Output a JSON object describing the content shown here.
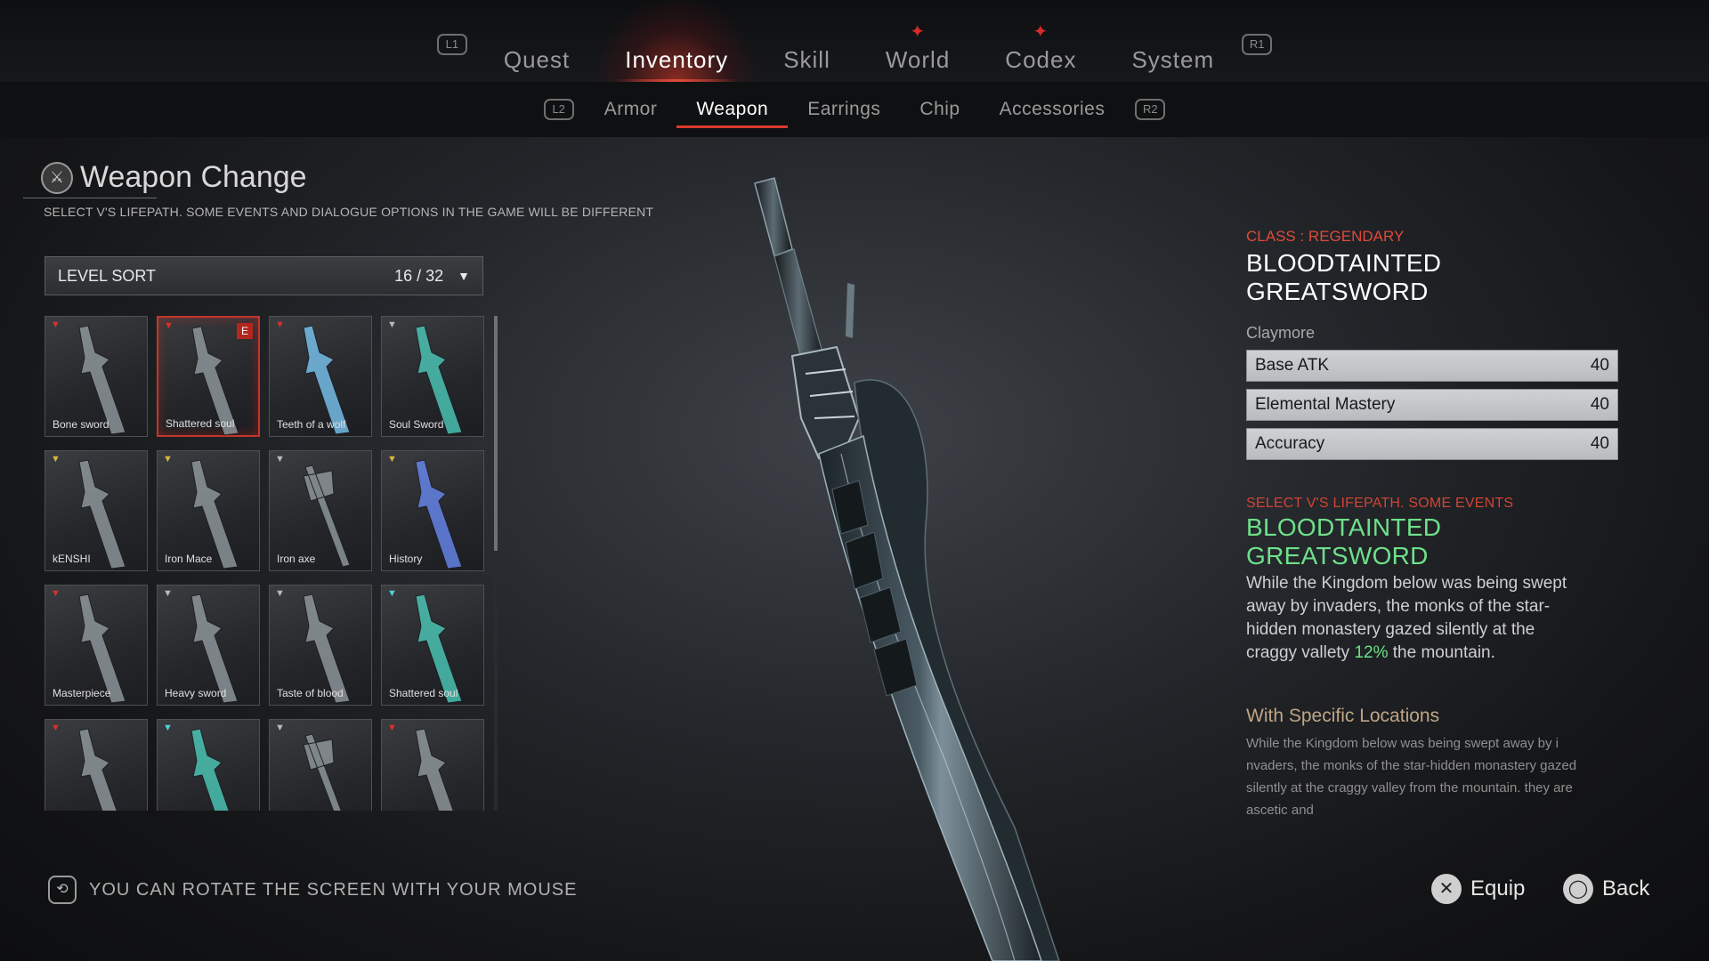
{
  "top_nav": {
    "left_hint": "L1",
    "right_hint": "R1",
    "tabs": [
      {
        "label": "Quest",
        "active": false,
        "badge": false
      },
      {
        "label": "Inventory",
        "active": true,
        "badge": false
      },
      {
        "label": "Skill",
        "active": false,
        "badge": false
      },
      {
        "label": "World",
        "active": false,
        "badge": true
      },
      {
        "label": "Codex",
        "active": false,
        "badge": true
      },
      {
        "label": "System",
        "active": false,
        "badge": false
      }
    ]
  },
  "sub_nav": {
    "left_hint": "L2",
    "right_hint": "R2",
    "tabs": [
      {
        "label": "Armor",
        "active": false
      },
      {
        "label": "Weapon",
        "active": true
      },
      {
        "label": "Earrings",
        "active": false
      },
      {
        "label": "Chip",
        "active": false
      },
      {
        "label": "Accessories",
        "active": false
      }
    ]
  },
  "panel": {
    "title": "Weapon Change",
    "subtitle": "SELECT V'S LIFEPATH. SOME EVENTS AND DIALOGUE OPTIONS IN THE GAME WILL BE DIFFERENT"
  },
  "sort": {
    "label": "LEVEL SORT",
    "count": "16 / 32"
  },
  "colors": {
    "accent_red": "#e04a3a",
    "highlight_green": "#6ee08a",
    "rarity_red": "#d9302a",
    "rarity_gold": "#d6b63a",
    "rarity_silver": "#b8b8b8",
    "rarity_cyan": "#4fd1d9"
  },
  "weapons": [
    {
      "label": "Bone sword",
      "rarity": "red",
      "selected": false,
      "equipped": false,
      "icon": "bone-sword-icon"
    },
    {
      "label": "Shattered soul",
      "rarity": "red",
      "selected": true,
      "equipped": true,
      "equipped_badge": "E",
      "icon": "shattered-soul-icon"
    },
    {
      "label": "Teeth of a wolf",
      "rarity": "red",
      "selected": false,
      "equipped": false,
      "icon": "teeth-of-a-wolf-icon"
    },
    {
      "label": "Soul Sword",
      "rarity": "silver",
      "selected": false,
      "equipped": false,
      "icon": "soul-sword-icon"
    },
    {
      "label": "kENSHI",
      "rarity": "gold",
      "selected": false,
      "equipped": false,
      "icon": "kenshi-icon"
    },
    {
      "label": "Iron Mace",
      "rarity": "gold",
      "selected": false,
      "equipped": false,
      "icon": "iron-mace-icon"
    },
    {
      "label": "Iron axe",
      "rarity": "silver",
      "selected": false,
      "equipped": false,
      "icon": "iron-axe-icon"
    },
    {
      "label": "History",
      "rarity": "gold",
      "selected": false,
      "equipped": false,
      "icon": "history-icon"
    },
    {
      "label": "Masterpiece",
      "rarity": "red",
      "selected": false,
      "equipped": false,
      "icon": "masterpiece-icon"
    },
    {
      "label": "Heavy sword",
      "rarity": "silver",
      "selected": false,
      "equipped": false,
      "icon": "heavy-sword-icon"
    },
    {
      "label": "Taste of blood",
      "rarity": "silver",
      "selected": false,
      "equipped": false,
      "icon": "taste-of-blood-icon"
    },
    {
      "label": "Shattered soul",
      "rarity": "cyan",
      "selected": false,
      "equipped": false,
      "icon": "shattered-soul-icon"
    },
    {
      "label": "",
      "rarity": "red",
      "selected": false,
      "equipped": false,
      "icon": "sword-icon"
    },
    {
      "label": "",
      "rarity": "cyan",
      "selected": false,
      "equipped": false,
      "icon": "sword-icon"
    },
    {
      "label": "",
      "rarity": "silver",
      "selected": false,
      "equipped": false,
      "icon": "axe-icon"
    },
    {
      "label": "",
      "rarity": "red",
      "selected": false,
      "equipped": false,
      "icon": "sword-icon"
    }
  ],
  "item": {
    "class_label": "CLASS : REGENDARY",
    "name": "BLOODTAINTED GREATSWORD",
    "type": "Claymore",
    "stats": [
      {
        "name": "Base ATK",
        "value": "40"
      },
      {
        "name": "Elemental Mastery",
        "value": "40"
      },
      {
        "name": "Accuracy",
        "value": "40"
      }
    ],
    "desc_kicker": "SELECT V'S LIFEPATH. SOME EVENTS",
    "desc_title": "BLOODTAINTED GREATSWORD",
    "desc_body_before": "While the Kingdom below was being swept away by invaders, the monks of the star-hidden monastery gazed silently at the craggy vallety ",
    "desc_highlight": "12%",
    "desc_body_after": " the mountain.",
    "locations_title": "With Specific Locations",
    "locations_body": "While the Kingdom below was being swept away by i nvaders, the monks of the star-hidden monastery gazed silently at the craggy valley from the mountain. they are ascetic and"
  },
  "footer": {
    "hint": "YOU CAN ROTATE THE SCREEN WITH YOUR MOUSE",
    "hint_icon": "mouse-rotate-icon",
    "equip_label": "Equip",
    "equip_icon": "cross-button-icon",
    "back_label": "Back",
    "back_icon": "circle-button-icon"
  }
}
